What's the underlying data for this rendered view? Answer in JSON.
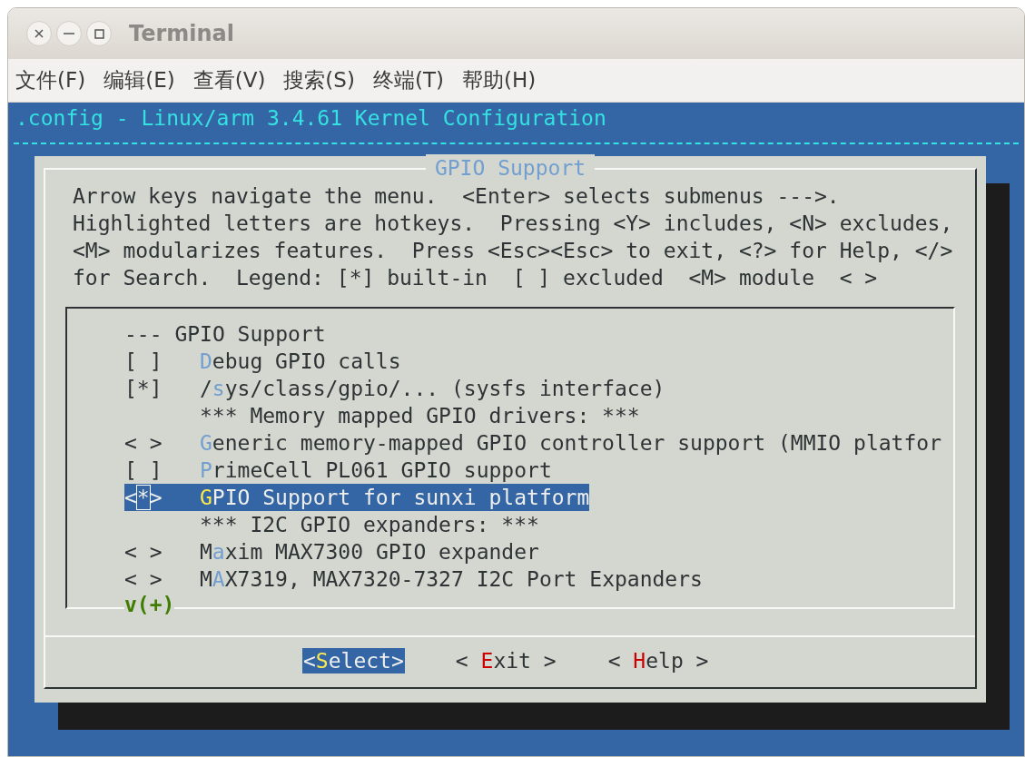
{
  "window": {
    "title": "Terminal"
  },
  "menubar": [
    "文件(F)",
    "编辑(E)",
    "查看(V)",
    "搜索(S)",
    "终端(T)",
    "帮助(H)"
  ],
  "header": ".config - Linux/arm 3.4.61 Kernel Configuration",
  "dialog": {
    "title": "GPIO Support",
    "help_lines": [
      "Arrow keys navigate the menu.  <Enter> selects submenus --->.",
      "Highlighted letters are hotkeys.  Pressing <Y> includes, <N> excludes,",
      "<M> modularizes features.  Press <Esc><Esc> to exit, <?> for Help, </>",
      "for Search.  Legend: [*] built-in  [ ] excluded  <M> module  < >"
    ],
    "items": [
      {
        "kind": "header",
        "prompt": "---",
        "pre": "GPIO Support",
        "selected": false
      },
      {
        "kind": "option",
        "prompt": "[ ]",
        "hotkey": "D",
        "post": "ebug GPIO calls",
        "selected": false
      },
      {
        "kind": "option",
        "prompt": "[*]",
        "pre": "/",
        "hotkey": "s",
        "post": "ys/class/gpio/... (sysfs interface)",
        "selected": false
      },
      {
        "kind": "comment",
        "pre": "*** Memory mapped GPIO drivers: ***",
        "selected": false
      },
      {
        "kind": "option",
        "prompt": "< >",
        "hotkey": "G",
        "post": "eneric memory-mapped GPIO controller support (MMIO platfor",
        "selected": false
      },
      {
        "kind": "option",
        "prompt": "[ ]",
        "hotkey": "P",
        "post": "rimeCell PL061 GPIO support",
        "selected": false
      },
      {
        "kind": "option",
        "prompt": "<*>",
        "hotkey": "G",
        "post": "PIO Support for sunxi platform",
        "selected": true
      },
      {
        "kind": "comment",
        "pre": "*** I2C GPIO expanders: ***",
        "selected": false
      },
      {
        "kind": "option",
        "prompt": "< >",
        "pre": "M",
        "hotkey": "a",
        "post": "xim MAX7300 GPIO expander",
        "selected": false
      },
      {
        "kind": "option",
        "prompt": "< >",
        "pre": "M",
        "hotkey": "A",
        "post": "X7319, MAX7320-7327 I2C Port Expanders",
        "selected": false
      }
    ],
    "more_indicator": "v(+)",
    "buttons": [
      {
        "pre": "<",
        "hotkey": "S",
        "post": "elect>",
        "selected": true
      },
      {
        "pre": "< ",
        "hotkey": "E",
        "post": "xit >",
        "selected": false
      },
      {
        "pre": "< ",
        "hotkey": "H",
        "post": "elp >",
        "selected": false
      }
    ]
  }
}
